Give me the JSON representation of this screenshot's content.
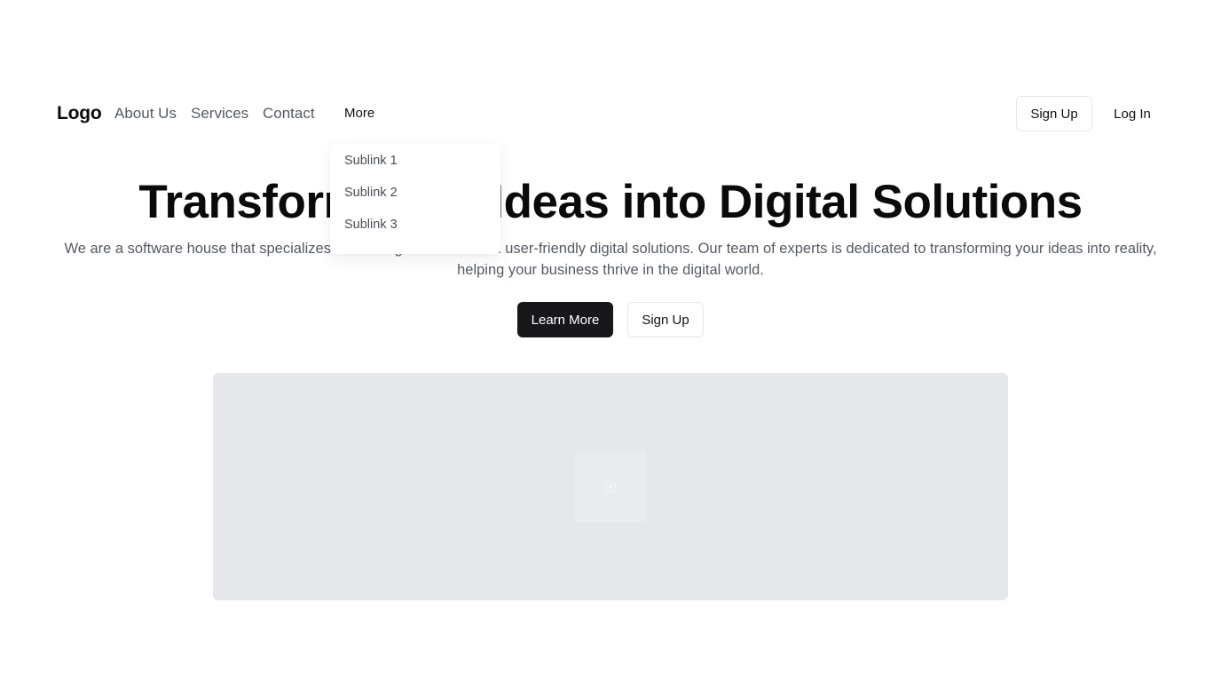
{
  "nav": {
    "logo": "Logo",
    "links": [
      "About Us",
      "Services",
      "Contact"
    ],
    "more_label": "More",
    "signup_label": "Sign Up",
    "login_label": "Log In"
  },
  "dropdown": {
    "items": [
      "Sublink 1",
      "Sublink 2",
      "Sublink 3"
    ]
  },
  "hero": {
    "title": "Transform Your Ideas into Digital Solutions",
    "description": "We are a software house that specializes in creating innovative and user-friendly digital solutions. Our team of experts is dedicated to transforming your ideas into reality, helping your business thrive in the digital world.",
    "primary_button": "Learn More",
    "secondary_button": "Sign Up"
  },
  "media": {
    "icon": "image-placeholder-icon"
  },
  "colors": {
    "primary_button_bg": "#18181b",
    "placeholder_bg": "#e5e7eb",
    "muted_text": "#555a63"
  }
}
